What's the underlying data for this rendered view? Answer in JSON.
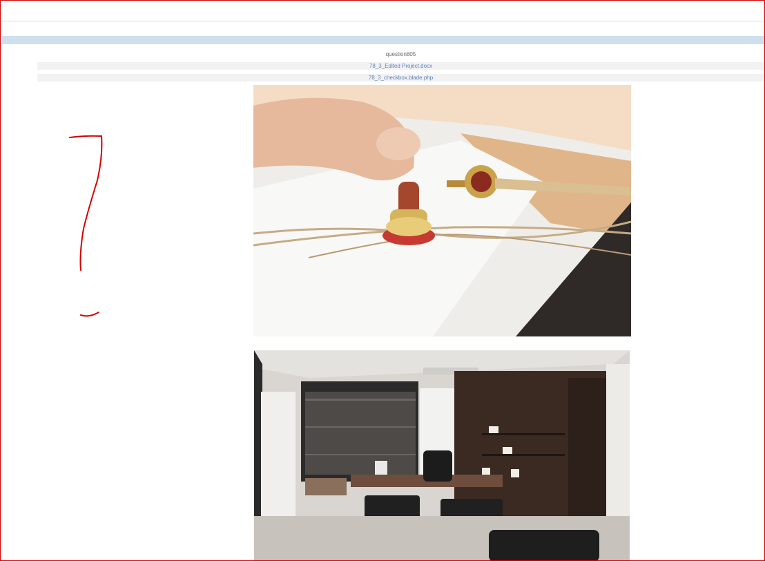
{
  "header": {
    "title": "question805"
  },
  "attachments": [
    {
      "name": "78_3_Edited Project.docx"
    },
    {
      "name": "78_3_checkbox.blade.php"
    }
  ],
  "images": [
    {
      "icon": "wax-seal-photo"
    },
    {
      "icon": "office-interior-photo"
    }
  ],
  "colors": {
    "annotation": "#d40000",
    "nav_strip": "#cfdfee",
    "link": "#5b80b8"
  }
}
